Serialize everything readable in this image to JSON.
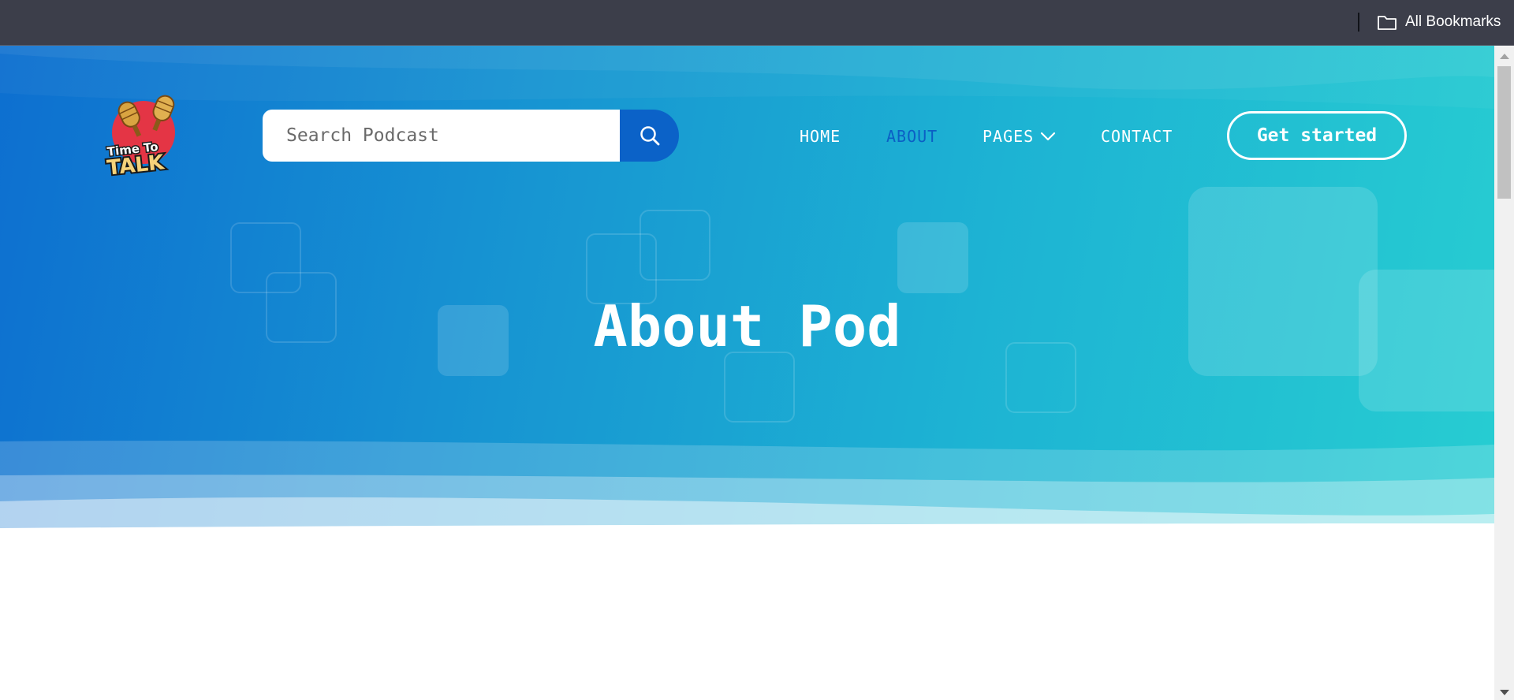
{
  "bookmarks_bar": {
    "all_bookmarks_label": "All Bookmarks",
    "folder_icon": "folder-icon"
  },
  "header": {
    "logo": {
      "line1": "Time To",
      "line2": "TALK",
      "icon": "microphone-icon"
    },
    "search": {
      "placeholder": "Search Podcast",
      "value": "",
      "button_icon": "search-icon"
    },
    "nav": [
      {
        "label": "HOME",
        "active": false
      },
      {
        "label": "ABOUT",
        "active": true
      },
      {
        "label": "PAGES",
        "active": false,
        "icon": "chevron-down-icon"
      },
      {
        "label": "CONTACT",
        "active": false
      }
    ],
    "cta_label": "Get started"
  },
  "hero": {
    "title": "About Pod"
  },
  "colors": {
    "bookmarks_bar_bg": "#3c3e4a",
    "hero_gradient_start": "#0d6fd0",
    "hero_gradient_end": "#27cdd2",
    "active_nav": "#0b5fc5",
    "search_button": "#0b62c8",
    "logo_red": "#e43545",
    "logo_gold": "#d9a441"
  }
}
